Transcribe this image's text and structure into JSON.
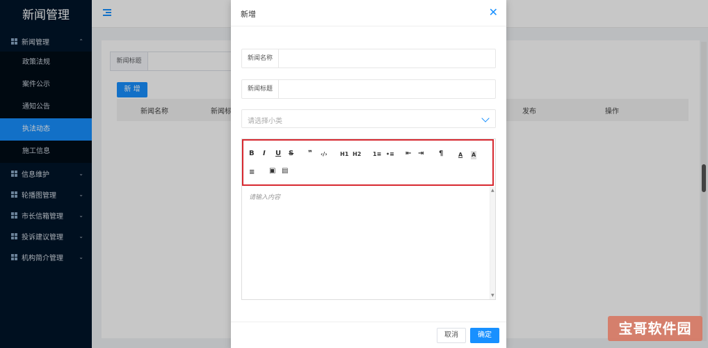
{
  "sidebar": {
    "logo": "新闻管理",
    "groups": [
      {
        "label": "新闻管理",
        "chevron": "^",
        "expanded": true,
        "items": [
          {
            "label": "政策法规"
          },
          {
            "label": "案件公示"
          },
          {
            "label": "通知公告"
          },
          {
            "label": "执法动态",
            "active": true
          },
          {
            "label": "施工信息"
          }
        ]
      },
      {
        "label": "信息维护",
        "chevron": "v"
      },
      {
        "label": "轮播图管理",
        "chevron": "v"
      },
      {
        "label": "市长信箱管理",
        "chevron": "v"
      },
      {
        "label": "投诉建议管理",
        "chevron": "v"
      },
      {
        "label": "机构简介管理",
        "chevron": "v"
      }
    ]
  },
  "page": {
    "filter_label": "新闻标题",
    "add_button": "新 增",
    "table_headers": [
      "新闻名称",
      "新闻标",
      "发布",
      "操作"
    ]
  },
  "modal": {
    "title": "新增",
    "close_icon": "✕",
    "name_label": "新闻名称",
    "name_value": "",
    "title_label": "新闻标题",
    "title_value": "",
    "select_placeholder": "请选择小类",
    "editor_placeholder": "请输入内容",
    "toolbar": {
      "bold": "B",
      "italic": "I",
      "underline": "U",
      "strike": "S",
      "quote": "❞",
      "code": "‹/›",
      "h1": "H1",
      "h2": "H2",
      "ordered_list": "1≡",
      "bullet_list": "•≡",
      "outdent": "⇤",
      "indent": "⇥",
      "direction": "¶",
      "font_color": "A",
      "bg_color": "A",
      "align": "≡",
      "image": "▣",
      "video": "▤"
    },
    "cancel_label": "取消",
    "ok_label": "确定"
  },
  "watermark": "宝哥软件园",
  "colors": {
    "sidebar_bg": "#001529",
    "accent": "#1890ff",
    "highlight_border": "#d7282f"
  }
}
